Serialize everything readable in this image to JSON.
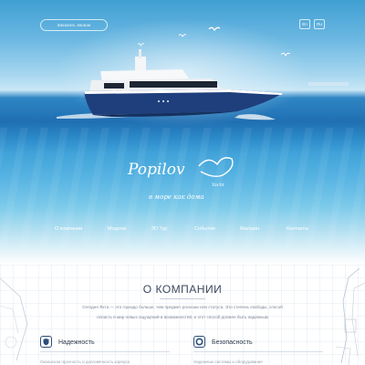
{
  "header": {
    "callback_label": "Заказать звонок",
    "languages": [
      "En",
      "Ru"
    ]
  },
  "brand": {
    "logo_text": "Popilov",
    "logo_sub": "Yacht",
    "slogan": "в море как дома"
  },
  "nav": {
    "items": [
      "О компании",
      "Модели",
      "3D Тур",
      "События",
      "Магазин",
      "Контакты"
    ]
  },
  "about": {
    "title": "О КОМПАНИИ",
    "intro_lines": [
      "Сегодня Яхта — это гораздо больше, чем предмет роскоши или статуса. Это степень свободы, способ",
      "попасть в мир новых ощущений и возможностей, и этот способ должен быть надежным"
    ],
    "features": [
      {
        "icon": "shield-icon",
        "title": "Надежность",
        "text": "Океанская прочность и долговечность корпуса"
      },
      {
        "icon": "lifebuoy-icon",
        "title": "Безопасность",
        "text": "Надежные системы и оборудование"
      }
    ]
  },
  "colors": {
    "hull": "#1f3f7c",
    "sea": "#2f86c4",
    "title_text": "#3c4a5e"
  }
}
